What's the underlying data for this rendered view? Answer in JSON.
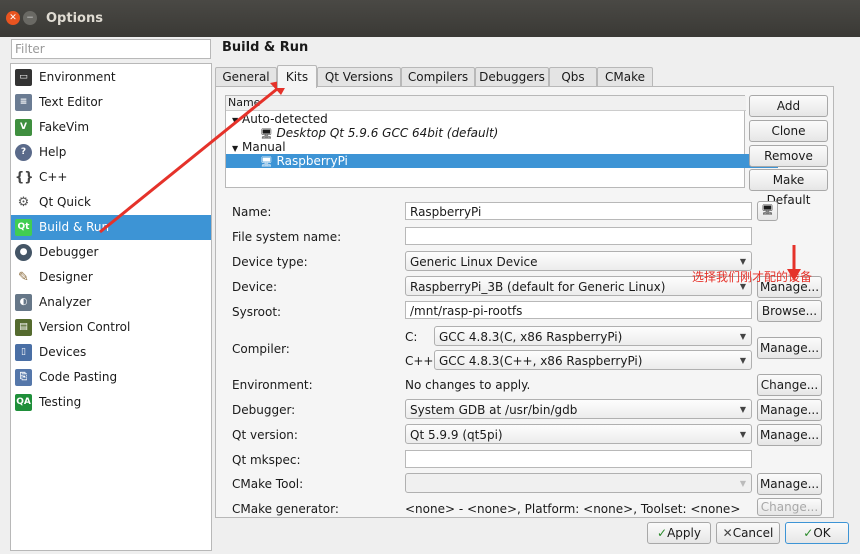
{
  "window": {
    "title": "Options"
  },
  "filter": {
    "placeholder": "Filter"
  },
  "nav": [
    {
      "label": "Environment",
      "icon": "monitor-icon",
      "color": "#333333"
    },
    {
      "label": "Text Editor",
      "icon": "text-editor-icon",
      "color": "#6b7c93"
    },
    {
      "label": "FakeVim",
      "icon": "fakevim-icon",
      "color": "#3f8f3f"
    },
    {
      "label": "Help",
      "icon": "help-icon",
      "color": "#5a6a8a"
    },
    {
      "label": "C++",
      "icon": "cpp-braces-icon",
      "color": "#555555"
    },
    {
      "label": "Qt Quick",
      "icon": "qt-quick-icon",
      "color": "#777777"
    },
    {
      "label": "Build & Run",
      "icon": "build-run-icon",
      "color": "#41cd52"
    },
    {
      "label": "Debugger",
      "icon": "debugger-bug-icon",
      "color": "#445566"
    },
    {
      "label": "Designer",
      "icon": "designer-pencil-icon",
      "color": "#8a6a3a"
    },
    {
      "label": "Analyzer",
      "icon": "analyzer-icon",
      "color": "#667788"
    },
    {
      "label": "Version Control",
      "icon": "version-control-icon",
      "color": "#556b2f"
    },
    {
      "label": "Devices",
      "icon": "devices-phone-icon",
      "color": "#4a6fa5"
    },
    {
      "label": "Code Pasting",
      "icon": "code-pasting-icon",
      "color": "#5577aa"
    },
    {
      "label": "Testing",
      "icon": "qa-testing-icon",
      "color": "#1f8f3a",
      "text": "QA"
    }
  ],
  "page": {
    "title": "Build & Run"
  },
  "tabs": [
    "General",
    "Kits",
    "Qt Versions",
    "Compilers",
    "Debuggers",
    "Qbs",
    "CMake"
  ],
  "tree": {
    "header": "Name",
    "groups": [
      {
        "label": "Auto-detected",
        "items": [
          "Desktop Qt 5.9.6 GCC 64bit (default)"
        ]
      },
      {
        "label": "Manual",
        "items": [
          "RaspberryPi"
        ]
      }
    ]
  },
  "kit_buttons": {
    "add": "Add",
    "clone": "Clone",
    "remove": "Remove",
    "make_default": "Make Default"
  },
  "form": {
    "name_label": "Name:",
    "name_value": "RaspberryPi",
    "fs_label": "File system name:",
    "fs_value": "",
    "devtype_label": "Device type:",
    "devtype_value": "Generic Linux Device",
    "device_label": "Device:",
    "device_value": "RaspberryPi_3B (default for Generic Linux)",
    "sysroot_label": "Sysroot:",
    "sysroot_value": "/mnt/rasp-pi-rootfs",
    "compiler_label": "Compiler:",
    "c_label": "C:",
    "c_value": "GCC 4.8.3(C, x86 RaspberryPi)",
    "cpp_label": "C++:",
    "cpp_value": "GCC 4.8.3(C++, x86 RaspberryPi)",
    "env_label": "Environment:",
    "env_value": "No changes to apply.",
    "debugger_label": "Debugger:",
    "debugger_value": "System GDB at /usr/bin/gdb",
    "qtver_label": "Qt version:",
    "qtver_value": "Qt 5.9.9 (qt5pi)",
    "mkspec_label": "Qt mkspec:",
    "mkspec_value": "",
    "cmake_tool_label": "CMake Tool:",
    "cmake_tool_value": "",
    "cmake_gen_label": "CMake generator:",
    "cmake_gen_value": "<none> - <none>, Platform: <none>, Toolset: <none>"
  },
  "side_buttons": {
    "manage": "Manage...",
    "browse": "Browse...",
    "change": "Change..."
  },
  "annotation": "选择我们刚才配的设备",
  "dialog_buttons": {
    "apply": "Apply",
    "cancel": "Cancel",
    "ok": "OK"
  },
  "colors": {
    "selection": "#3d94d5",
    "annotation": "#e5322a"
  }
}
